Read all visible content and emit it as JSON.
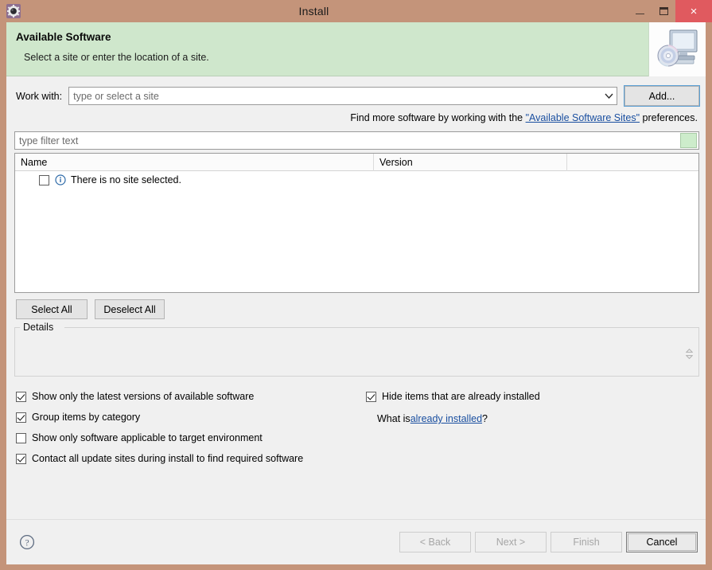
{
  "window": {
    "title": "Install",
    "icon": "gear-icon",
    "controls": {
      "minimize": "–",
      "maximize": "❐",
      "close": "×"
    },
    "colors": {
      "titlebar": "#c4947a",
      "header_band": "#cfe7cc",
      "close_button": "#e05a5f",
      "body": "#f0f0f0",
      "link": "#1a4fa0"
    }
  },
  "header": {
    "title": "Available Software",
    "subtitle": "Select a site or enter the location of a site.",
    "banner_icon": "monitor-with-cd-icon"
  },
  "work_with": {
    "label": "Work with:",
    "value": "",
    "placeholder": "type or select a site",
    "dropdown_icon": "chevron-down-icon",
    "add_button": "Add..."
  },
  "hint": {
    "prefix": "Find more software by working with the ",
    "link": "\"Available Software Sites\"",
    "suffix": " preferences."
  },
  "filter": {
    "value": "",
    "placeholder": "type filter text",
    "clear_button_icon": "clear-filter-icon"
  },
  "table": {
    "columns": [
      "Name",
      "Version",
      ""
    ],
    "rows": [
      {
        "checked": false,
        "icon": "info-icon",
        "name": "There is no site selected.",
        "version": ""
      }
    ]
  },
  "select_buttons": {
    "select_all": "Select All",
    "deselect_all": "Deselect All"
  },
  "details": {
    "label": "Details",
    "content": "",
    "spinner_icon": "up-down-spinner-icon"
  },
  "options": {
    "left": [
      {
        "label": "Show only the latest versions of available software",
        "checked": true
      },
      {
        "label": "Group items by category",
        "checked": true
      },
      {
        "label": "Show only software applicable to target environment",
        "checked": false
      },
      {
        "label": "Contact all update sites during install to find required software",
        "checked": true
      }
    ],
    "right": [
      {
        "label": "Hide items that are already installed",
        "checked": true
      }
    ],
    "what_is": {
      "prefix": "What is ",
      "link": "already installed",
      "suffix": "?"
    }
  },
  "footer": {
    "help_icon": "help-question-icon",
    "buttons": [
      {
        "label": "< Back",
        "enabled": false
      },
      {
        "label": "Next >",
        "enabled": false
      },
      {
        "label": "Finish",
        "enabled": false
      },
      {
        "label": "Cancel",
        "enabled": true
      }
    ]
  }
}
